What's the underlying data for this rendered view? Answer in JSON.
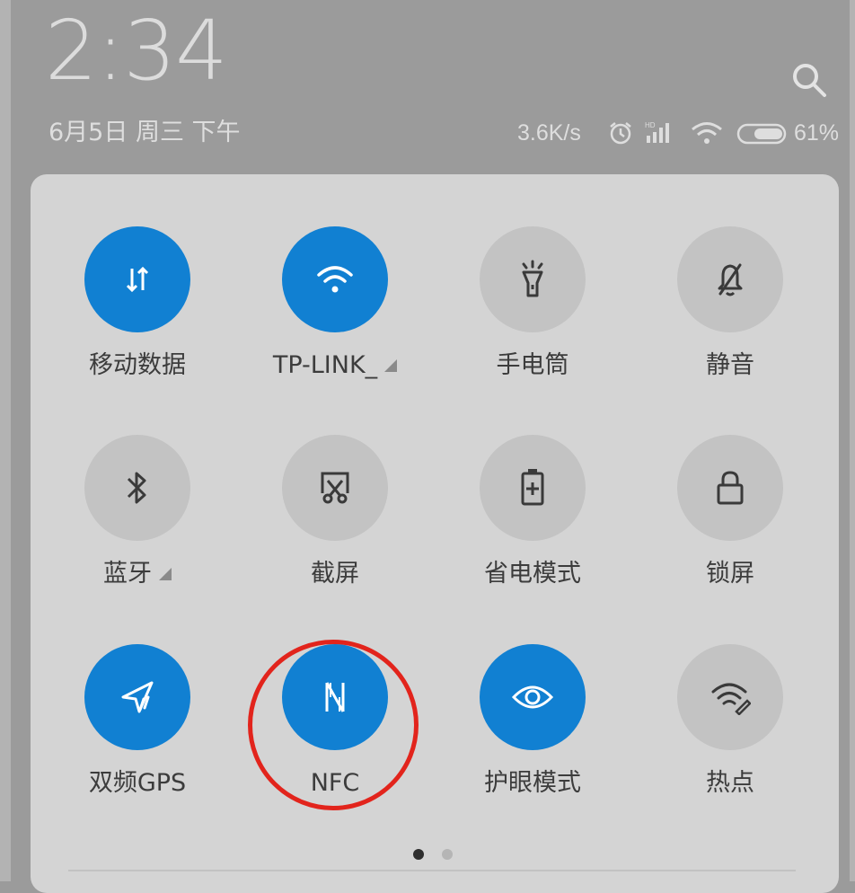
{
  "status": {
    "time": "2:34",
    "date": "6月5日 周三 下午",
    "net_speed": "3.6K/s",
    "battery_percent": "61%",
    "search_icon": "search-icon"
  },
  "page_indicator": {
    "current": 1,
    "total": 2
  },
  "colors": {
    "active": "#1180d2",
    "inactive": "#c3c3c3",
    "annotation": "#e2241c"
  },
  "tiles": [
    {
      "label": "移动数据",
      "icon": "mobile-data-icon",
      "active": true
    },
    {
      "label": "TP-LINK_",
      "icon": "wifi-icon",
      "active": true,
      "has_arrow": true
    },
    {
      "label": "手电筒",
      "icon": "flashlight-icon",
      "active": false
    },
    {
      "label": "静音",
      "icon": "mute-bell-icon",
      "active": false
    },
    {
      "label": "蓝牙",
      "icon": "bluetooth-icon",
      "active": false,
      "has_arrow": true
    },
    {
      "label": "截屏",
      "icon": "screenshot-icon",
      "active": false
    },
    {
      "label": "省电模式",
      "icon": "battery-saver-icon",
      "active": false
    },
    {
      "label": "锁屏",
      "icon": "lock-icon",
      "active": false
    },
    {
      "label": "双频GPS",
      "icon": "gps-icon",
      "active": true
    },
    {
      "label": "NFC",
      "icon": "nfc-icon",
      "active": true,
      "highlighted": true
    },
    {
      "label": "护眼模式",
      "icon": "eye-care-icon",
      "active": true
    },
    {
      "label": "热点",
      "icon": "hotspot-icon",
      "active": false
    }
  ]
}
